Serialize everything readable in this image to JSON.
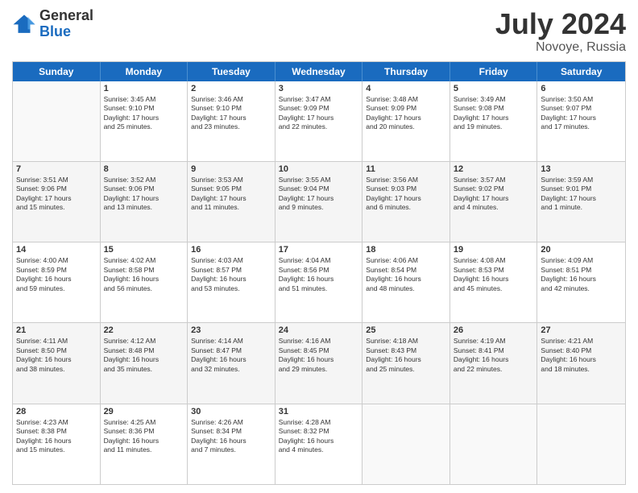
{
  "header": {
    "logo_general": "General",
    "logo_blue": "Blue",
    "month_title": "July 2024",
    "location": "Novoye, Russia"
  },
  "days_of_week": [
    "Sunday",
    "Monday",
    "Tuesday",
    "Wednesday",
    "Thursday",
    "Friday",
    "Saturday"
  ],
  "weeks": [
    [
      {
        "day": "",
        "info": ""
      },
      {
        "day": "1",
        "info": "Sunrise: 3:45 AM\nSunset: 9:10 PM\nDaylight: 17 hours\nand 25 minutes."
      },
      {
        "day": "2",
        "info": "Sunrise: 3:46 AM\nSunset: 9:10 PM\nDaylight: 17 hours\nand 23 minutes."
      },
      {
        "day": "3",
        "info": "Sunrise: 3:47 AM\nSunset: 9:09 PM\nDaylight: 17 hours\nand 22 minutes."
      },
      {
        "day": "4",
        "info": "Sunrise: 3:48 AM\nSunset: 9:09 PM\nDaylight: 17 hours\nand 20 minutes."
      },
      {
        "day": "5",
        "info": "Sunrise: 3:49 AM\nSunset: 9:08 PM\nDaylight: 17 hours\nand 19 minutes."
      },
      {
        "day": "6",
        "info": "Sunrise: 3:50 AM\nSunset: 9:07 PM\nDaylight: 17 hours\nand 17 minutes."
      }
    ],
    [
      {
        "day": "7",
        "info": "Sunrise: 3:51 AM\nSunset: 9:06 PM\nDaylight: 17 hours\nand 15 minutes."
      },
      {
        "day": "8",
        "info": "Sunrise: 3:52 AM\nSunset: 9:06 PM\nDaylight: 17 hours\nand 13 minutes."
      },
      {
        "day": "9",
        "info": "Sunrise: 3:53 AM\nSunset: 9:05 PM\nDaylight: 17 hours\nand 11 minutes."
      },
      {
        "day": "10",
        "info": "Sunrise: 3:55 AM\nSunset: 9:04 PM\nDaylight: 17 hours\nand 9 minutes."
      },
      {
        "day": "11",
        "info": "Sunrise: 3:56 AM\nSunset: 9:03 PM\nDaylight: 17 hours\nand 6 minutes."
      },
      {
        "day": "12",
        "info": "Sunrise: 3:57 AM\nSunset: 9:02 PM\nDaylight: 17 hours\nand 4 minutes."
      },
      {
        "day": "13",
        "info": "Sunrise: 3:59 AM\nSunset: 9:01 PM\nDaylight: 17 hours\nand 1 minute."
      }
    ],
    [
      {
        "day": "14",
        "info": "Sunrise: 4:00 AM\nSunset: 8:59 PM\nDaylight: 16 hours\nand 59 minutes."
      },
      {
        "day": "15",
        "info": "Sunrise: 4:02 AM\nSunset: 8:58 PM\nDaylight: 16 hours\nand 56 minutes."
      },
      {
        "day": "16",
        "info": "Sunrise: 4:03 AM\nSunset: 8:57 PM\nDaylight: 16 hours\nand 53 minutes."
      },
      {
        "day": "17",
        "info": "Sunrise: 4:04 AM\nSunset: 8:56 PM\nDaylight: 16 hours\nand 51 minutes."
      },
      {
        "day": "18",
        "info": "Sunrise: 4:06 AM\nSunset: 8:54 PM\nDaylight: 16 hours\nand 48 minutes."
      },
      {
        "day": "19",
        "info": "Sunrise: 4:08 AM\nSunset: 8:53 PM\nDaylight: 16 hours\nand 45 minutes."
      },
      {
        "day": "20",
        "info": "Sunrise: 4:09 AM\nSunset: 8:51 PM\nDaylight: 16 hours\nand 42 minutes."
      }
    ],
    [
      {
        "day": "21",
        "info": "Sunrise: 4:11 AM\nSunset: 8:50 PM\nDaylight: 16 hours\nand 38 minutes."
      },
      {
        "day": "22",
        "info": "Sunrise: 4:12 AM\nSunset: 8:48 PM\nDaylight: 16 hours\nand 35 minutes."
      },
      {
        "day": "23",
        "info": "Sunrise: 4:14 AM\nSunset: 8:47 PM\nDaylight: 16 hours\nand 32 minutes."
      },
      {
        "day": "24",
        "info": "Sunrise: 4:16 AM\nSunset: 8:45 PM\nDaylight: 16 hours\nand 29 minutes."
      },
      {
        "day": "25",
        "info": "Sunrise: 4:18 AM\nSunset: 8:43 PM\nDaylight: 16 hours\nand 25 minutes."
      },
      {
        "day": "26",
        "info": "Sunrise: 4:19 AM\nSunset: 8:41 PM\nDaylight: 16 hours\nand 22 minutes."
      },
      {
        "day": "27",
        "info": "Sunrise: 4:21 AM\nSunset: 8:40 PM\nDaylight: 16 hours\nand 18 minutes."
      }
    ],
    [
      {
        "day": "28",
        "info": "Sunrise: 4:23 AM\nSunset: 8:38 PM\nDaylight: 16 hours\nand 15 minutes."
      },
      {
        "day": "29",
        "info": "Sunrise: 4:25 AM\nSunset: 8:36 PM\nDaylight: 16 hours\nand 11 minutes."
      },
      {
        "day": "30",
        "info": "Sunrise: 4:26 AM\nSunset: 8:34 PM\nDaylight: 16 hours\nand 7 minutes."
      },
      {
        "day": "31",
        "info": "Sunrise: 4:28 AM\nSunset: 8:32 PM\nDaylight: 16 hours\nand 4 minutes."
      },
      {
        "day": "",
        "info": ""
      },
      {
        "day": "",
        "info": ""
      },
      {
        "day": "",
        "info": ""
      }
    ]
  ]
}
